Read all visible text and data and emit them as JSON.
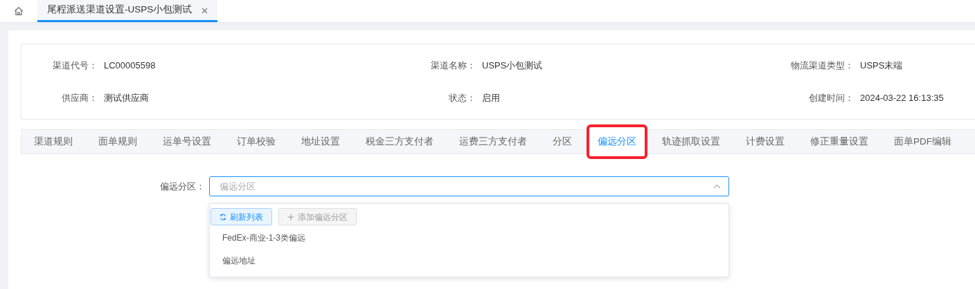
{
  "page_tabs": [
    {
      "label": "尾程派送渠道设置-USPS小包测试",
      "selected": true,
      "closable": true
    }
  ],
  "info": [
    {
      "label": "渠道代号：",
      "value": "LC00005598"
    },
    {
      "label": "渠道名称：",
      "value": "USPS小包测试"
    },
    {
      "label": "物流渠道类型：",
      "value": "USPS末端"
    },
    {
      "label": "供应商：",
      "value": "测试供应商"
    },
    {
      "label": "状态：",
      "value": "启用"
    },
    {
      "label": "创建时间：",
      "value": "2024-03-22 16:13:35"
    }
  ],
  "tabs": [
    {
      "label": "渠道规则",
      "selected": false
    },
    {
      "label": "面单规则",
      "selected": false
    },
    {
      "label": "运单号设置",
      "selected": false
    },
    {
      "label": "订单校验",
      "selected": false
    },
    {
      "label": "地址设置",
      "selected": false
    },
    {
      "label": "税金三方支付者",
      "selected": false
    },
    {
      "label": "运费三方支付者",
      "selected": false
    },
    {
      "label": "分区",
      "selected": false
    },
    {
      "label": "偏远分区",
      "selected": true,
      "highlighted": true
    },
    {
      "label": "轨迹抓取设置",
      "selected": false
    },
    {
      "label": "计费设置",
      "selected": false
    },
    {
      "label": "修正重量设置",
      "selected": false
    },
    {
      "label": "面单PDF编辑",
      "selected": false
    }
  ],
  "form": {
    "label": "偏远分区：",
    "placeholder": "偏远分区",
    "expanded": true,
    "dropdown": {
      "buttons": [
        {
          "label": "刷新列表",
          "kind": "refresh",
          "disabled": false
        },
        {
          "label": "添加偏远分区",
          "kind": "add",
          "disabled": true
        }
      ],
      "options": [
        "FedEx-商业-1-3类偏远",
        "偏远地址"
      ]
    }
  }
}
